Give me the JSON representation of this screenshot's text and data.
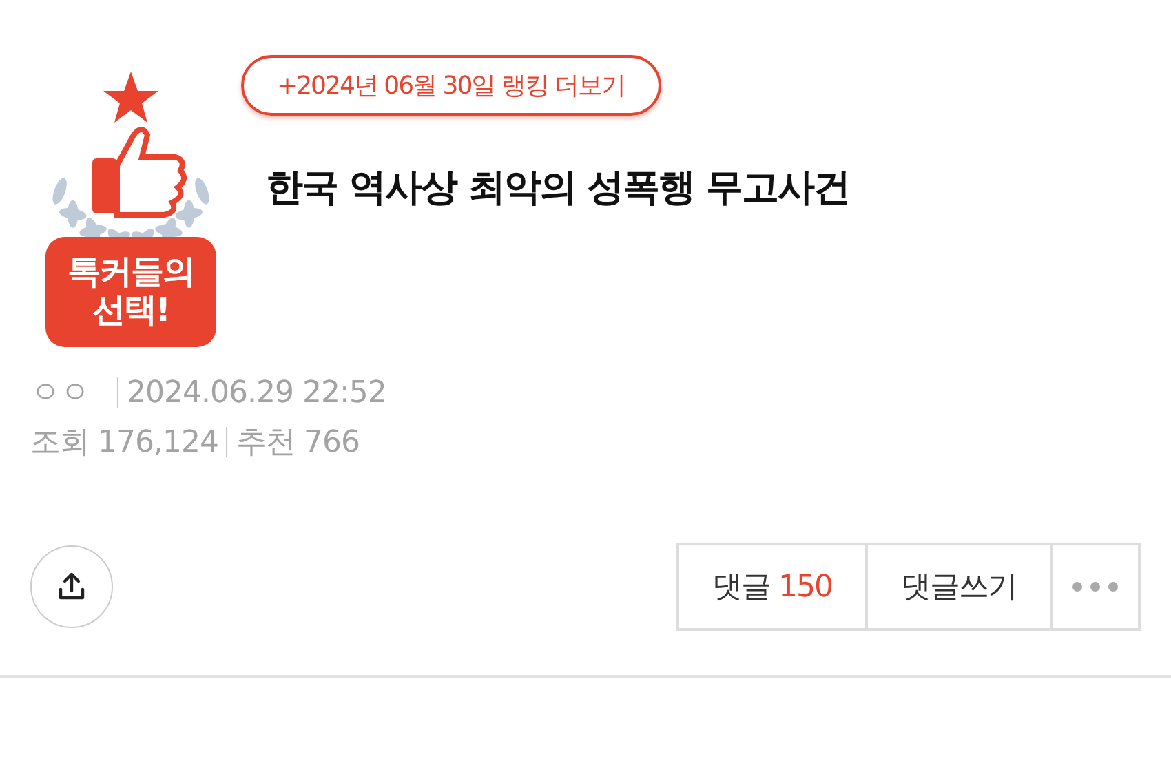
{
  "badge": {
    "line_1": "톡커들의",
    "line_2": "선택!"
  },
  "ranking_link": "+2024년 06월 30일 랭킹 더보기",
  "title": "한국 역사상 최악의 성폭행 무고사건",
  "meta": {
    "author": "ㅇㅇ",
    "date": "2024.06.29 22:52",
    "views_label": "조회",
    "views": "176,124",
    "likes_label": "추천",
    "likes": "766"
  },
  "actions": {
    "comments_label": "댓글",
    "comments_count": "150",
    "write_comment": "댓글쓰기"
  }
}
